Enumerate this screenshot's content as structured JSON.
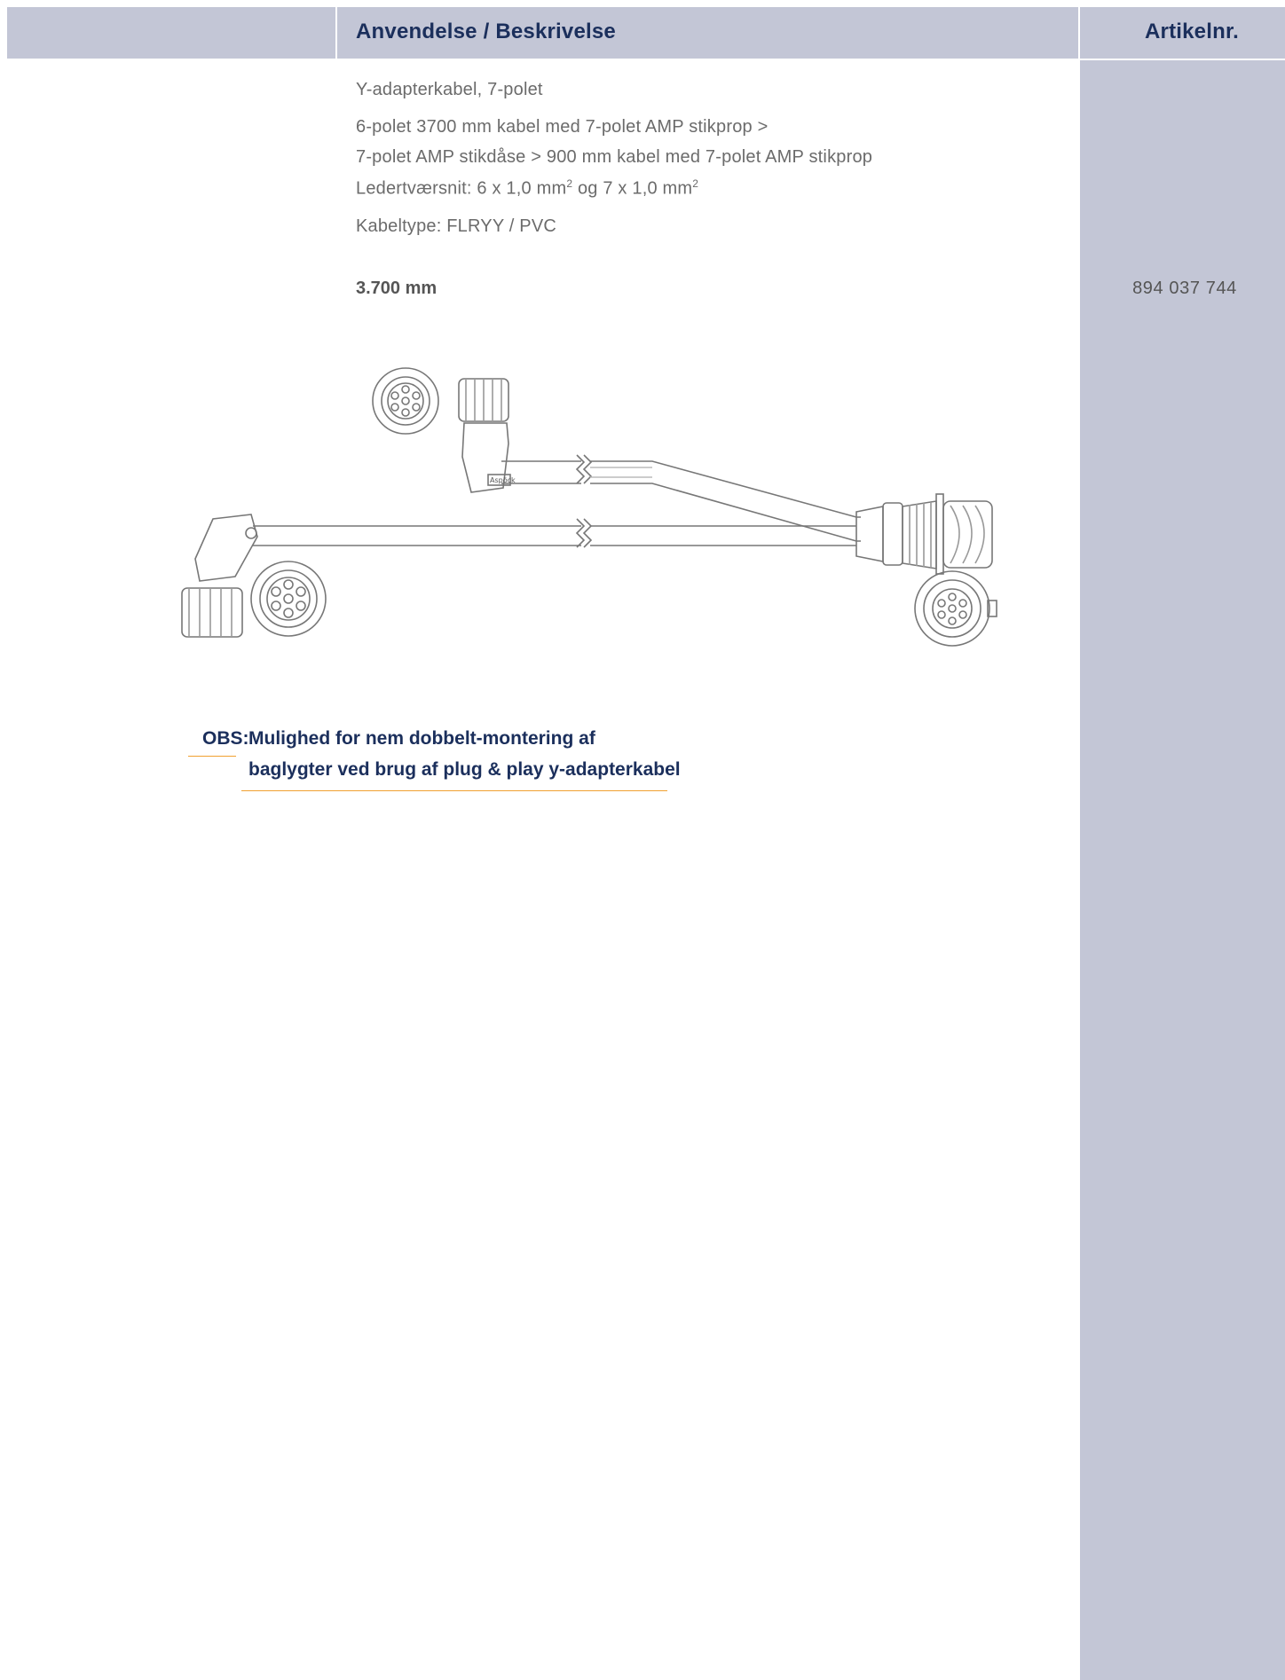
{
  "header": {
    "description_heading": "Anvendelse / Beskrivelse",
    "article_heading": "Artikelnr."
  },
  "product": {
    "title": "Y-adapterkabel, 7-polet",
    "line1": "6-polet 3700 mm kabel med 7-polet AMP stikprop >",
    "line2": "7-polet AMP stikdåse > 900 mm kabel med 7-polet AMP stikprop",
    "cross_section_prefix": "Ledertværsnit: 6 x 1,0 mm",
    "cross_section_mid": " og 7 x 1,0 mm",
    "superscript": "2",
    "cable_type": "Kabeltype: FLRYY / PVC",
    "length": "3.700 mm",
    "article_number": "894 037 744"
  },
  "note": {
    "label": "OBS:",
    "line1": "Mulighed for nem dobbelt-montering af",
    "line2": "baglygter ved brug af plug & play y-adapterkabel"
  },
  "colors": {
    "header_bg": "#c3c6d6",
    "heading_text": "#1b2f5c",
    "accent_rule": "#f0a030"
  },
  "drawing": {
    "icon": "y-adapter-cable-drawing",
    "logo_text": "Aspöck"
  }
}
